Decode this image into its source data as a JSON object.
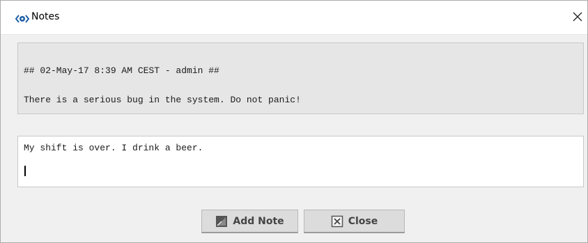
{
  "window": {
    "title": "Notes",
    "icons": {
      "app": "notes-eye-icon",
      "close": "close-icon"
    },
    "colors": {
      "accent": "#1f5fa8",
      "history_bg": "#e6e6e6",
      "button_bg": "#dcdcdc"
    }
  },
  "history": {
    "lines": [
      "## 02-May-17 8:39 AM CEST - admin ##",
      "There is a serious bug in the system. Do not panic!"
    ]
  },
  "input": {
    "value": "My shift is over. I drink a beer."
  },
  "buttons": {
    "add_note": {
      "label": "Add Note",
      "icon": "add-note-icon"
    },
    "close": {
      "label": "Close",
      "icon": "close-box-icon"
    }
  }
}
